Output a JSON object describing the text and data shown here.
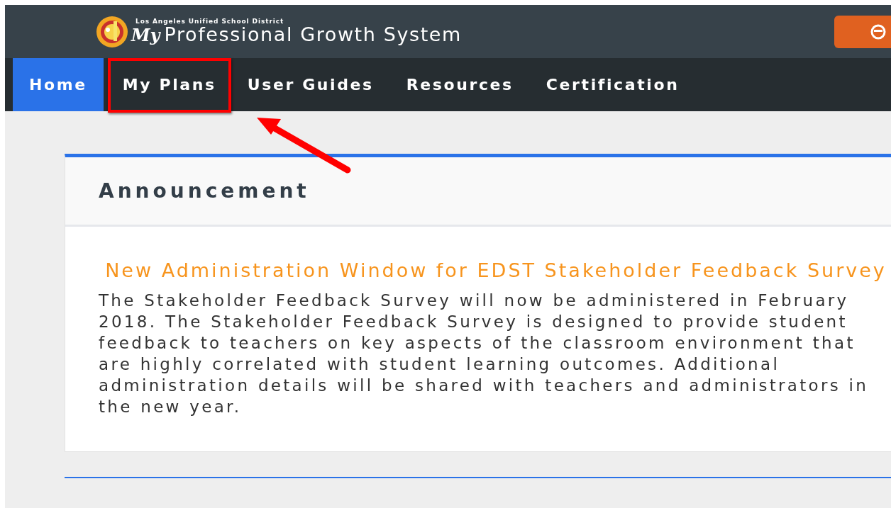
{
  "header": {
    "district": "Los Angeles Unified School District",
    "logo_script": "My",
    "title": "Professional Growth System"
  },
  "nav": [
    {
      "label": "Home",
      "selected": true,
      "highlighted": false
    },
    {
      "label": "My Plans",
      "selected": false,
      "highlighted": true
    },
    {
      "label": "User Guides",
      "selected": false,
      "highlighted": false
    },
    {
      "label": "Resources",
      "selected": false,
      "highlighted": false
    },
    {
      "label": "Certification",
      "selected": false,
      "highlighted": false
    }
  ],
  "announcement": {
    "heading": "Announcement",
    "title": "New Administration Window for EDST Stakeholder Feedback Survey",
    "body": "The Stakeholder Feedback Survey will now be administered in February 2018. The Stakeholder Feedback Survey is designed to provide student feedback to teachers on key aspects of the classroom environment that are highly correlated with student learning outcomes. Additional administration details will be shared with teachers and administrators in the new year."
  }
}
